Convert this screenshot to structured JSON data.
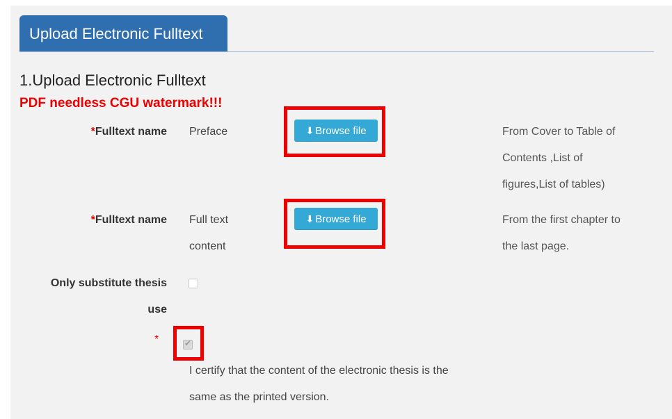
{
  "tab": {
    "label": "Upload Electronic Fulltext"
  },
  "section": {
    "title": "1.Upload Electronic Fulltext",
    "warning": "PDF needless CGU watermark!!!"
  },
  "fields": [
    {
      "required_mark": "*",
      "label": "Fulltext name",
      "value": "Preface",
      "button_label": "Browse file",
      "hint_lines": [
        "From Cover to Table of",
        "Contents ,List of",
        "figures,List of tables)"
      ]
    },
    {
      "required_mark": "*",
      "label": "Fulltext name",
      "value_lines": [
        "Full text",
        "content"
      ],
      "button_label": "Browse file",
      "hint_lines": [
        "From the first chapter to",
        "the last page."
      ]
    }
  ],
  "substitute": {
    "label_lines": [
      "Only substitute thesis",
      "use"
    ],
    "checked": false
  },
  "certify": {
    "required_mark": "*",
    "checked": true,
    "text_lines": [
      "I certify that the content of the electronic thesis is the",
      "same as the printed version."
    ]
  },
  "colors": {
    "tab_bg": "#2f6fb0",
    "button_bg": "#35a9d6",
    "warning": "#ee0000",
    "highlight_box": "#ee0000"
  },
  "icons": {
    "browse": "download-icon",
    "checkbox_checked": "checkmark-icon"
  }
}
